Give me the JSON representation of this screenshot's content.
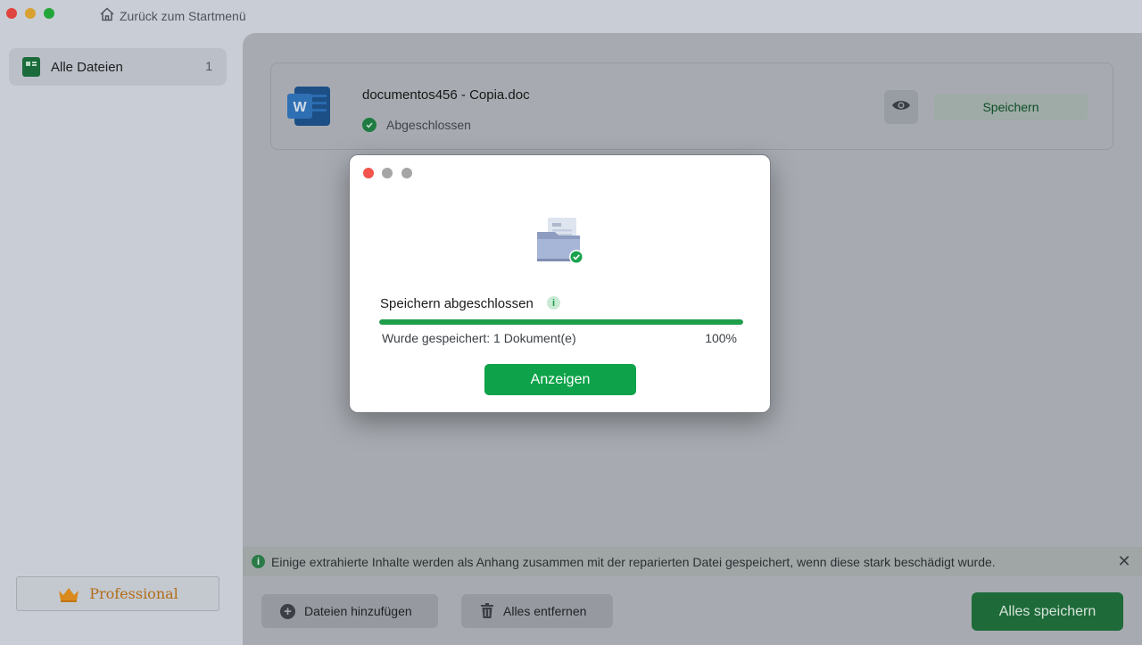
{
  "titlebar": {
    "back_label": "Zurück zum Startmenü",
    "back_icon": "home-icon"
  },
  "sidebar": {
    "items": [
      {
        "label": "Alle Dateien",
        "count": "1",
        "icon": "folder-icon"
      }
    ],
    "upgrade_label": "Professional",
    "upgrade_icon": "crown-icon"
  },
  "file_card": {
    "name": "documentos456 - Copia.doc",
    "status": "Abgeschlossen",
    "icon": "word-document-icon",
    "preview_icon": "eye-icon",
    "save_label": "Speichern"
  },
  "info_bar": {
    "text": "Einige extrahierte Inhalte werden als Anhang zusammen mit der reparierten Datei gespeichert, wenn diese stark beschädigt wurde.",
    "close_symbol": "✕"
  },
  "footer": {
    "add_label": "Dateien hinzufügen",
    "remove_label": "Alles entfernen",
    "save_all_label": "Alles speichern"
  },
  "modal": {
    "title": "Speichern abgeschlossen",
    "saved_text": "Wurde gespeichert: 1 Dokument(e)",
    "percent_label": "100%",
    "progress": 1.0,
    "button_label": "Anzeigen"
  },
  "colors": {
    "accent_green": "#0ea34a",
    "progress_green": "#1f9e4b",
    "close_red": "#f2534b"
  }
}
